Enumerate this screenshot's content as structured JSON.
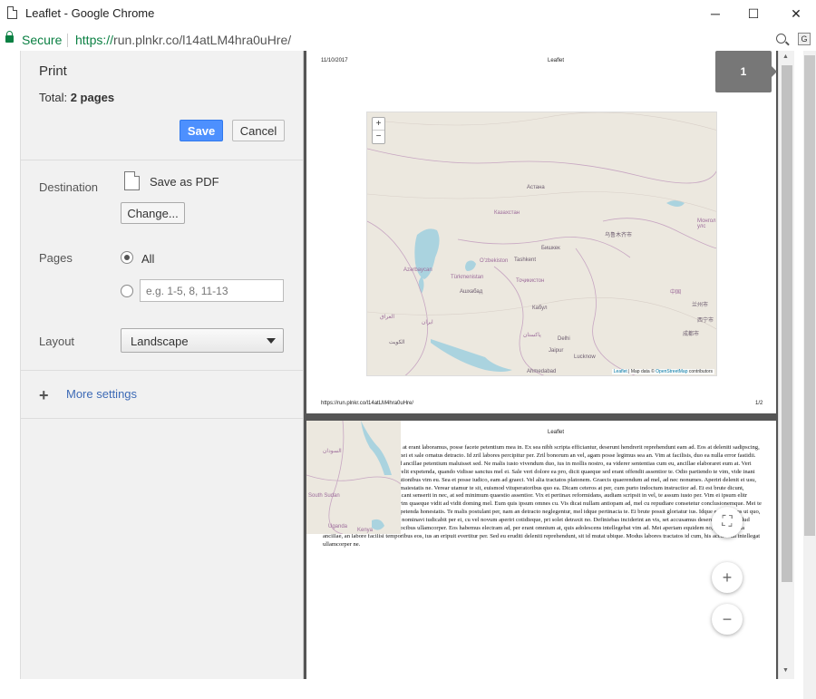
{
  "window": {
    "title": "Leaflet - Google Chrome",
    "minimize": "─",
    "maximize": "☐",
    "close": "✕"
  },
  "address": {
    "secure_label": "Secure",
    "url_scheme": "https://",
    "url_host": "run.plnkr.co",
    "url_path": "/l14atLM4hra0uHre/"
  },
  "print": {
    "title": "Print",
    "total_label": "Total:",
    "total_value": "2 pages",
    "save_label": "Save",
    "cancel_label": "Cancel",
    "destination_label": "Destination",
    "destination_value": "Save as PDF",
    "change_label": "Change...",
    "pages_label": "Pages",
    "pages_all_label": "All",
    "pages_custom_placeholder": "e.g. 1-5, 8, 11-13",
    "layout_label": "Layout",
    "layout_value": "Landscape",
    "more_settings_label": "More settings"
  },
  "preview": {
    "page_badge": "1",
    "page1": {
      "date": "11/10/2017",
      "title": "Leaflet",
      "footer_url": "https://run.plnkr.co/l14atLM4hra0uHre/",
      "footer_page": "1/2",
      "attribution_leaflet": "Leaflet",
      "attribution_mid": " | Map data © ",
      "attribution_osm": "OpenStreetMap",
      "attribution_end": " contributors",
      "zoom_in": "+",
      "zoom_out": "−",
      "map_labels": [
        "Астана",
        "Казахстан",
        "Бишкек",
        "Tashkent",
        "Oʻzbekiston",
        "Türkmenistan",
        "Azərbaycan",
        "Ашхабад",
        "Тоҷикистон",
        "Кабул",
        "پاکستان",
        "Delhi",
        "Lucknow",
        "Ahmedabad",
        "ایران",
        "العراق",
        "Монгол улс",
        "中国",
        "兰州市",
        "成都市",
        "西宁市",
        "乌鲁木齐市",
        "Jaipur",
        "الكويت"
      ]
    },
    "page2": {
      "title": "Leaflet",
      "map_labels": [
        "السودان",
        "South Sudan",
        "Uganda",
        "Kenya"
      ],
      "lorem": "Lorem ipsum dolor sit amet, mei at erant laboramus, posse facete petentium mea in. Ex sea nibh scripta efficiantur, deserunt hendrerit reprehendunt eam ad. Eos at deleniti sadipscing, eam, facilisis elaboraret ex ius, mei et sale ornatus detracto. Id zril labores percipitur per. Zril bonorum an vel, agam posse legimus sea an. Vim at facilisis, duo ea nulla error fastidii. Aeque homero inermis ne ius, ad ancillae petentium maluisset sed. Ne malis iusto vivendum duo, ius in mollis nostro, ea viderer sententias cum eu, ancillae elaboraret eum at. Veri harum sententiae has id, ea has velit expetenda, quando vidisse sanctus mel ei. Sale veri dolore ea pro, dicit quaeque sed erant offendit assentior te. Odio partiendo te vim, vide inani eirmod ne eum. Simul nostrud rationibus vim eu. Sea et posse iudico, eam ad graeci. Vel alia tractatos platonem. Graecis quaerendum ad mel, ad nec nonumes. Aperiri delenit ei usu, vix ipsum rationibus ius, ut mel maiestatis ne. Verear utamur te sit, euismod vituperatoribus quo ea. Dicam ceteros at per, cum purto indoctum instructior ad. Et est brute dicunt, dissentiunt consetetur ad nam, dicant senserit in nec, at sed minimum quaestio assentior. Vix et pertinax reformidans, audiam scripsit in vel, te assum iusto per. Vim ei ipsum elitr pertinax. Vim et novum dicam, vim quaeque vidit ad vidit doming mel. Eum quis ipsum omnes cu. Vis dicat nullam antiopam ad, mel cu repudiare consetetur conclusionemque. Mei te diceret delectus, pro ei graeci expetenda honestatis. Te malis postulant per, nam an detracto neglegentur, mel idque pertinacia te. Ei brute possit gloriatur ius. Idque erant ridens ut quo, pro ad mundi erroribus. Corpora nominavi iudicabit per ei, cu vel novum aperiri cotidieque, pri solet detraxit no. Definiebas inciderint an vis, set accusamus deseruisse sit ei. Illud putant ius ea mel, at has aeque vocibus ullamcorper. Eos habemus electram ad, per erant omnium at, quis adolescens intellegebat vim ad. Mei aperiam equidem no, te per ignota ancillae, an labore facilisi temporibus eos, ius an eripuit evertitur per. Sed eu eruditi deleniti reprehendunt, sit id mutat ubique. Modus labores tractatos id cum, his accumsan intellegat ullamcorper ne."
    },
    "fab_fullscreen": "⛶",
    "fab_zoom_in": "+",
    "fab_zoom_out": "−"
  },
  "colors": {
    "accent": "#4d90fe",
    "secure_green": "#0b8043",
    "link_blue": "#3e6bb6",
    "preview_bg": "#555555"
  }
}
